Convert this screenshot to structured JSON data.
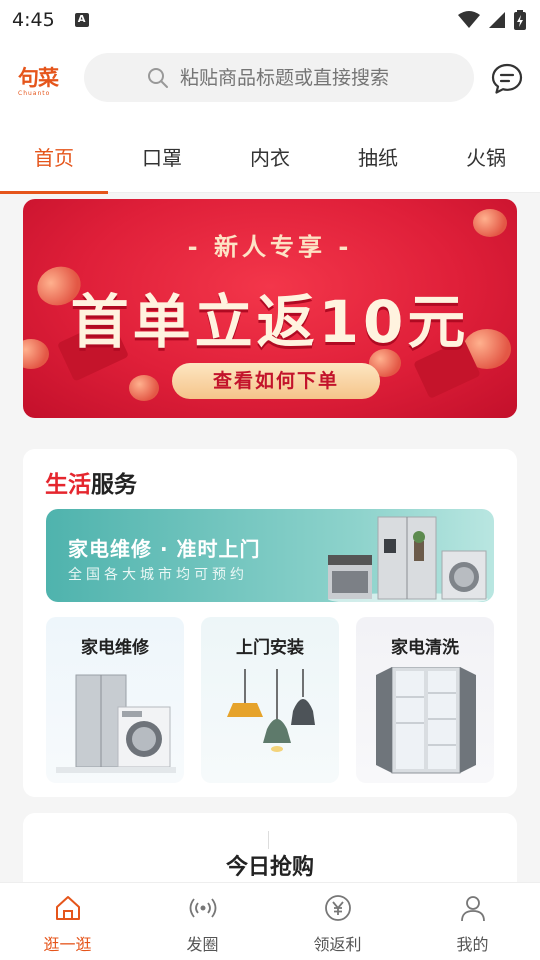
{
  "status_bar": {
    "time": "4:45",
    "notification_badge": "A"
  },
  "header": {
    "logo_mark": "句菜",
    "logo_sub": "Chuanto",
    "search_placeholder": "粘贴商品标题或直接搜索",
    "message_icon": "chat-bubble-icon"
  },
  "tabs": [
    {
      "label": "首页",
      "active": true
    },
    {
      "label": "口罩",
      "active": false
    },
    {
      "label": "内衣",
      "active": false
    },
    {
      "label": "抽纸",
      "active": false
    },
    {
      "label": "火锅",
      "active": false
    }
  ],
  "banner": {
    "tag": "- 新人专享 -",
    "headline": "首单立返10元",
    "cta": "查看如何下单"
  },
  "life_service": {
    "title_red": "生活",
    "title_black": "服务",
    "wide_card": {
      "title": "家电维修 · 准时上门",
      "subtitle": "全国各大城市均可预约"
    },
    "cards": [
      {
        "label": "家电维修"
      },
      {
        "label": "上门安装"
      },
      {
        "label": "家电清洗"
      }
    ]
  },
  "today": {
    "title": "今日抢购"
  },
  "bottom_nav": [
    {
      "label": "逛一逛",
      "icon": "home-icon",
      "active": true
    },
    {
      "label": "发圈",
      "icon": "broadcast-icon",
      "active": false
    },
    {
      "label": "领返利",
      "icon": "yuan-coin-icon",
      "active": false
    },
    {
      "label": "我的",
      "icon": "user-icon",
      "active": false
    }
  ],
  "colors": {
    "accent": "#e5551b",
    "banner_red": "#df1f39",
    "service_teal": "#4fb3ad"
  }
}
